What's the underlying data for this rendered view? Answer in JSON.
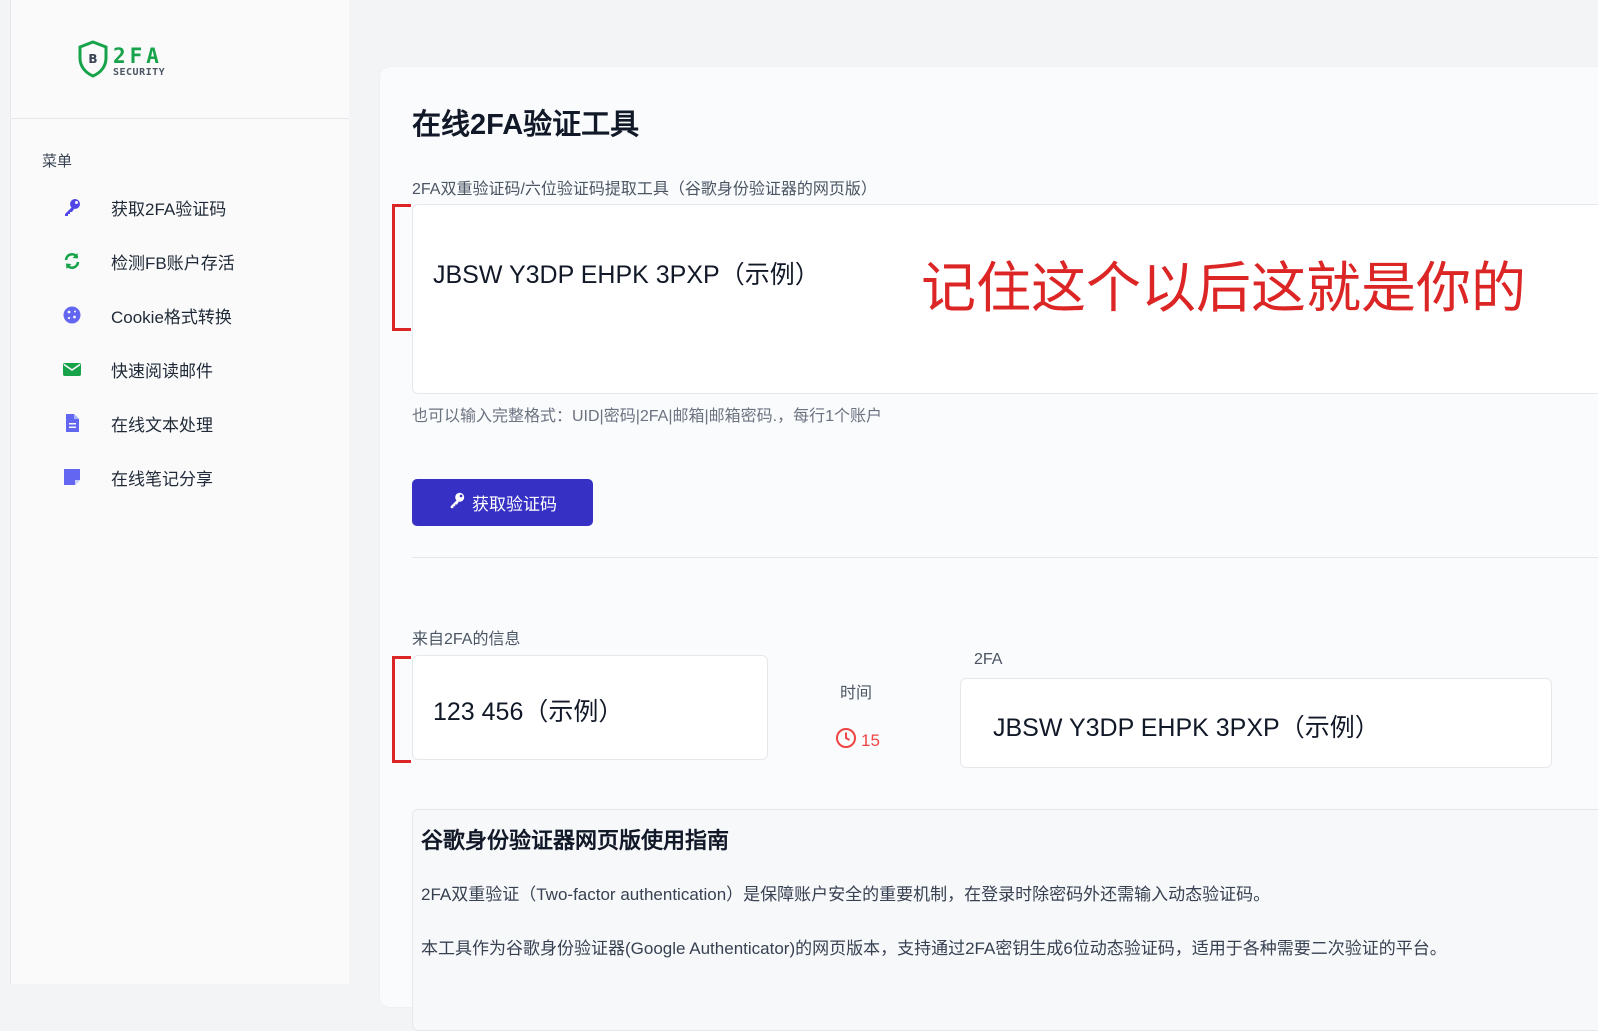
{
  "sidebar": {
    "logo": {
      "main": "2FA",
      "sub": "SECURITY",
      "badge": "B"
    },
    "menu_title": "菜单",
    "items": [
      {
        "label": "获取2FA验证码",
        "icon": "key-icon",
        "color": "#4f46e5"
      },
      {
        "label": "检测FB账户存活",
        "icon": "refresh-icon",
        "color": "#16a34a"
      },
      {
        "label": "Cookie格式转换",
        "icon": "cookie-icon",
        "color": "#6366f1"
      },
      {
        "label": "快速阅读邮件",
        "icon": "envelope-icon",
        "color": "#16a34a"
      },
      {
        "label": "在线文本处理",
        "icon": "document-icon",
        "color": "#6366f1"
      },
      {
        "label": "在线笔记分享",
        "icon": "note-icon",
        "color": "#6366f1"
      }
    ]
  },
  "main": {
    "title": "在线2FA验证工具",
    "subtitle": "2FA双重验证码/六位验证码提取工具（谷歌身份验证器的网页版）",
    "secret_input_value": "JBSW Y3DP EHPK 3PXP（示例）",
    "overlay_note": "记住这个以后这就是你的",
    "hint": "也可以输入完整格式：UID|密码|2FA|邮箱|邮箱密码.，每行1个账户",
    "get_button": "获取验证码",
    "from_label": "来自2FA的信息",
    "code_value": "123 456（示例）",
    "time_label": "时间",
    "timer_value": "15",
    "twofa_label": "2FA",
    "twofa_value": "JBSW Y3DP EHPK 3PXP（示例）"
  },
  "guide": {
    "title": "谷歌身份验证器网页版使用指南",
    "p1": "2FA双重验证（Two-factor authentication）是保障账户安全的重要机制，在登录时除密码外还需输入动态验证码。",
    "p2": "本工具作为谷歌身份验证器(Google Authenticator)的网页版本，支持通过2FA密钥生成6位动态验证码，适用于各种需要二次验证的平台。"
  },
  "colors": {
    "accent": "#3730c4",
    "annotation": "#dc2626",
    "timer": "#ef4444",
    "brand": "#16a34a"
  }
}
